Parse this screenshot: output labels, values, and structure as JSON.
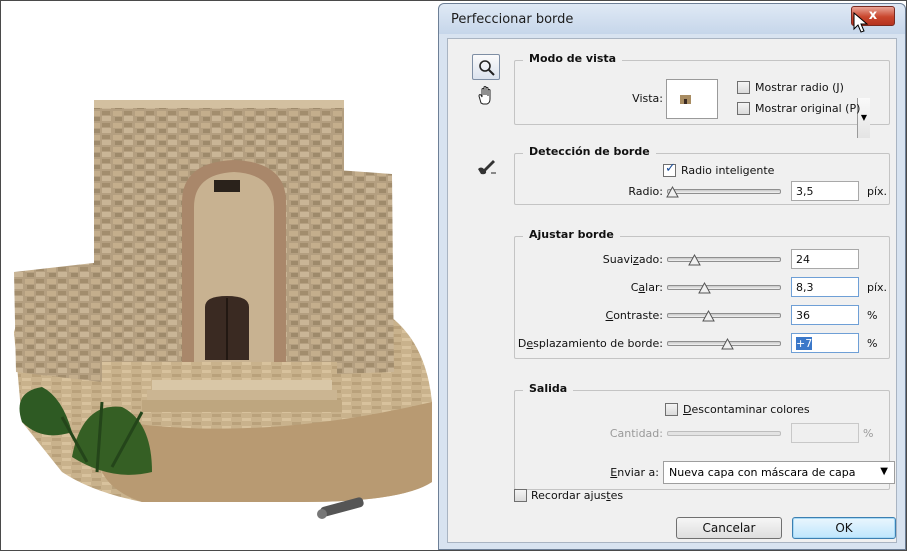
{
  "dialog": {
    "title": "Perfeccionar borde",
    "close_label": "x"
  },
  "tools": {
    "zoom": "zoom-icon",
    "hand": "hand-icon",
    "refine_brush": "refine-radius-brush-icon"
  },
  "view_mode": {
    "legend": "Modo de vista",
    "view_label": "Vista:",
    "show_radius_label": "Mostrar radio (J)",
    "show_radius_checked": false,
    "show_original_label": "Mostrar original (P)",
    "show_original_checked": false
  },
  "edge_detection": {
    "legend": "Detección de borde",
    "smart_radius_label": "Radio inteligente",
    "smart_radius_checked": true,
    "radius_label": "Radio:",
    "radius_value": "3,5",
    "radius_unit": "píx.",
    "radius_level": 0.04
  },
  "adjust_edge": {
    "legend": "Ajustar borde",
    "smooth_label": "Suavizado:",
    "smooth_value": "24",
    "smooth_level": 0.24,
    "feather_label": "Calar:",
    "feather_value": "8,3",
    "feather_unit": "píx.",
    "feather_level": 0.33,
    "contrast_label": "Contraste:",
    "contrast_value": "36",
    "contrast_unit": "%",
    "contrast_level": 0.36,
    "shift_label": "Desplazamiento de borde:",
    "shift_value": "+7",
    "shift_unit": "%",
    "shift_level": 0.535
  },
  "output": {
    "legend": "Salida",
    "decontaminate_label": "Descontaminar colores",
    "decontaminate_checked": false,
    "amount_label": "Cantidad:",
    "amount_value": "",
    "amount_unit": "%",
    "send_label": "Enviar a:",
    "send_value": "Nueva capa con máscara de capa"
  },
  "remember_label": "Recordar ajustes",
  "remember_checked": false,
  "buttons": {
    "cancel": "Cancelar",
    "ok": "OK"
  },
  "colors": {
    "accent": "#3b78c9",
    "title_bar": "#c6d6ea",
    "close_button": "#c9462d"
  }
}
